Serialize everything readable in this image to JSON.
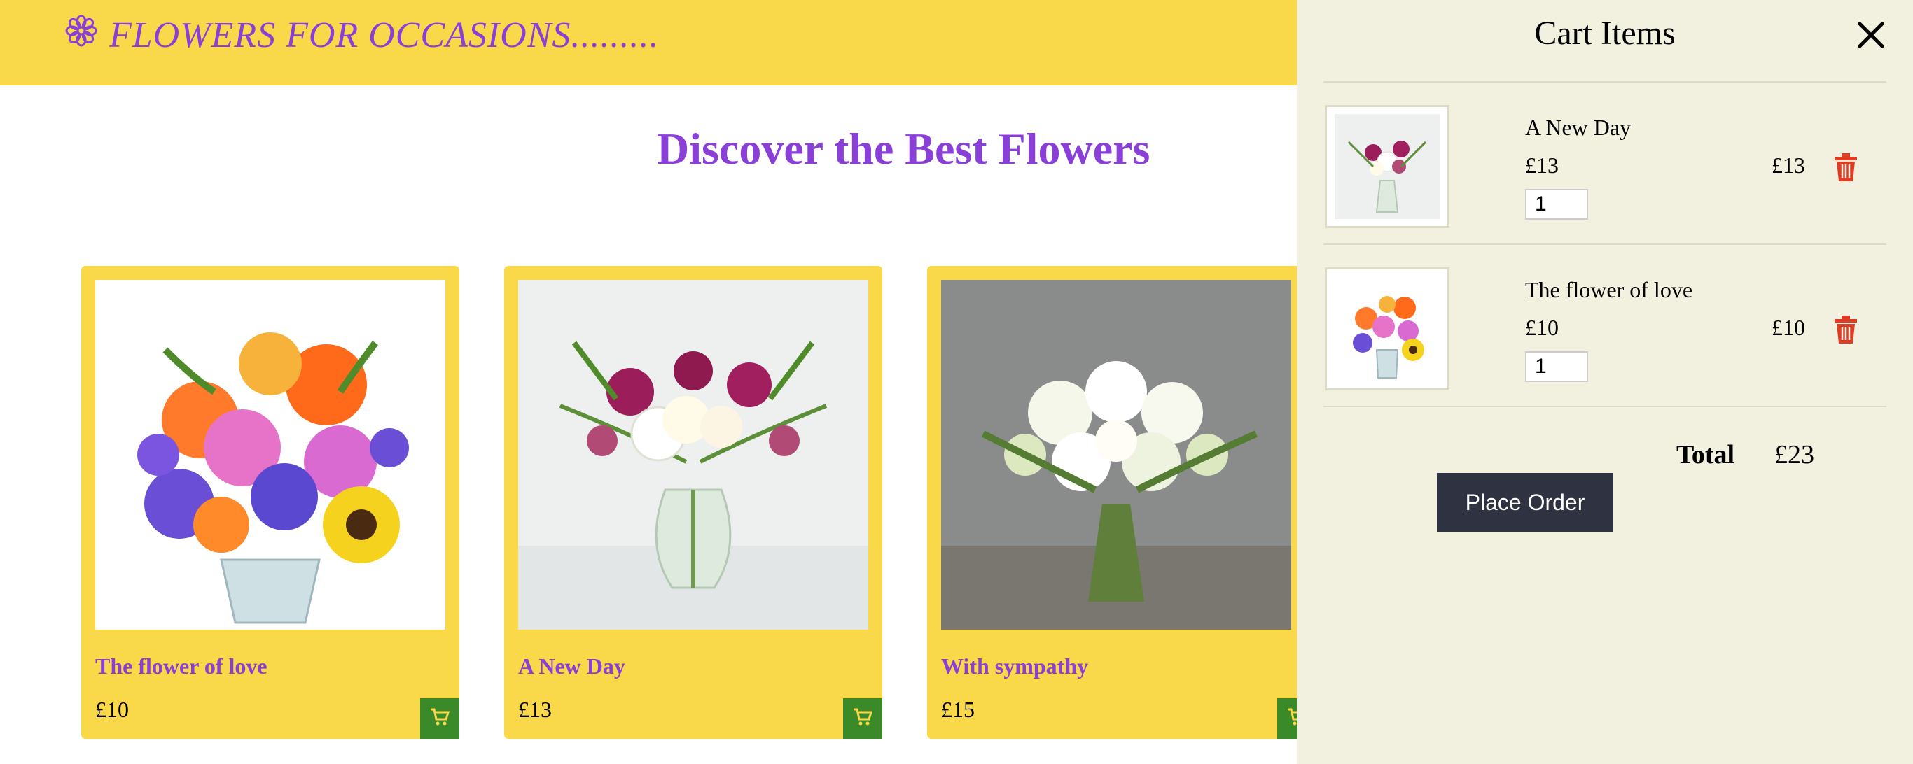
{
  "header": {
    "brand_text": "FLOWERS FOR OCCASIONS.........",
    "brand_icon": "flower-icon",
    "bg_color": "#f9d84a",
    "brand_color": "#8b3fd9"
  },
  "main": {
    "title": "Discover the Best Flowers"
  },
  "products": [
    {
      "name": "The flower of love",
      "price": "£10"
    },
    {
      "name": "A New Day",
      "price": "£13"
    },
    {
      "name": "With sympathy",
      "price": "£15"
    }
  ],
  "cart": {
    "title": "Cart Items",
    "close_icon": "close-icon",
    "items": [
      {
        "name": "A New Day",
        "price": "£13",
        "quantity": "1",
        "line_total": "£13"
      },
      {
        "name": "The flower of love",
        "price": "£10",
        "quantity": "1",
        "line_total": "£10"
      }
    ],
    "total_label": "Total",
    "total_value": "£23",
    "place_order_label": "Place Order",
    "panel_bg": "#f2f1df",
    "trash_color": "#e03b24",
    "add_cart_color": "#3a8a2a"
  }
}
